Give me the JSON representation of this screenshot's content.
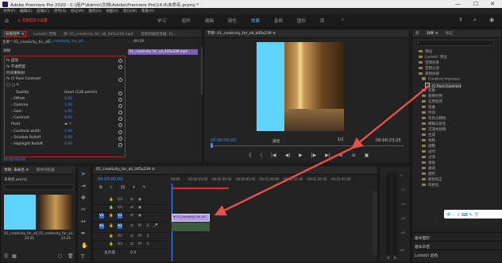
{
  "window": {
    "title": "Adobe Premiere Pro 2020 - C:\\用户\\Admin\\文档\\Adobe\\Premiere Pro\\14.0\\未命名.prproj *",
    "minimize": "—",
    "maximize": "☐",
    "close": "✕"
  },
  "menu": {
    "items": [
      "文件(F)",
      "编辑(E)",
      "剪辑(C)",
      "序列(S)",
      "标记(M)",
      "图形(G)",
      "视图(V)",
      "窗口(W)",
      "帮助(H)"
    ]
  },
  "workspaces": {
    "items": [
      "学习",
      "组件",
      "编辑",
      "颜色",
      "效果",
      "音频",
      "图形",
      "库"
    ],
    "active_index": 4,
    "more": "»"
  },
  "warning": {
    "text": "⚠ 无需自定义设置"
  },
  "effect_controls": {
    "tabs": [
      "效果控件 ≡",
      "Lumetri 范围",
      "源: 01_creativity_for_all_445x239.mp4",
      "音频剪辑混合器: 01..."
    ],
    "source": "主要 * 01_creativity_for_all...",
    "clip": "01_creativity_for_all...",
    "timecode_top": ":00:00",
    "clip_bar": "01_creativity_for_all_445x239.mp4",
    "section": "视频",
    "rows": [
      {
        "label": "fx  运动"
      },
      {
        "label": "fx  不透明度"
      },
      {
        "label": "    时间重映射"
      },
      {
        "label": "fx  CI Pure Contrast"
      },
      {
        "label": "    ◯ ▢ ✎"
      },
      {
        "label": "Quality",
        "value": "Good (128 points)"
      },
      {
        "label": "› Offset",
        "value": "0.00"
      },
      {
        "label": "› Gamma",
        "value": "1.00"
      },
      {
        "label": "› Gain",
        "value": "1.00"
      },
      {
        "label": "› Contrast",
        "value": "0.00"
      },
      {
        "label": "  Pivot",
        "value": "▬ ✎"
      },
      {
        "label": "› Contrast width",
        "value": "1.00"
      },
      {
        "label": "› Shadow Rolloff",
        "value": "0.00"
      },
      {
        "label": "› Highlight Rolloff",
        "value": "0.00"
      }
    ],
    "timecode": "00:00:00:00"
  },
  "program_monitor": {
    "tab": "节目: 01_creativity_for_all_445x239 ≡",
    "timecode_left": "00:00:00:00",
    "fit": "适合",
    "quality": "1/2",
    "timecode_right": "00:00:23:25",
    "controls": [
      "{",
      "⟨",
      "|◀",
      "◀|",
      "▶",
      "|▶",
      "▶|",
      "⊕",
      "⊖",
      "▣"
    ],
    "colors": {
      "placeholder": "#5fd4ff"
    }
  },
  "effects_panel": {
    "tabs": [
      "库",
      "效果 ≡",
      "标记"
    ],
    "items": [
      "预设",
      "Lumetri 预设",
      "音频效果",
      "音频过渡",
      "视频效果",
      "Creative Impulses",
      "Ci Pure Contrast",
      "变换",
      "图像控制",
      "实用程序",
      "扭曲",
      "时间",
      "杂色与颗粒",
      "模糊与锐化",
      "沉浸式视频",
      "生成",
      "视频",
      "调整",
      "过时",
      "过渡",
      "透视",
      "通道",
      "键控",
      "颜色校正",
      "风格化"
    ],
    "bottom_items": [
      "基本图形",
      "基本声音",
      "Lumetri 颜色"
    ]
  },
  "project_panel": {
    "tabs": [
      "项目: 未命名 ≡",
      "媒体浏览器"
    ],
    "name": "未命名.prproj",
    "clip_name": "01_creativity_for_all_44...",
    "clip_duration": "23:25",
    "sequence_name": "01_creativity_for_all...",
    "sequence_duration": "23:25"
  },
  "timeline": {
    "tab": "01_creativity_for_all_445x239 ≡",
    "timecode": "00:00:00:00",
    "ruler": [
      "00:00",
      "00:00:15:00",
      "00:00:30:00",
      "00:00:45:00",
      "00:01:00:00",
      "00:01:15:00",
      "00:01:30:00",
      "00:01:45:00"
    ],
    "tracks": [
      "V3",
      "V2",
      "V1",
      "A1",
      "A2",
      "A3"
    ],
    "master": "主声道",
    "master_value": "0.0",
    "clip_label": "fx 01_creativity_for_all"
  },
  "taskbar_ime": {
    "label": "中 ⁘ ♪ ⌨ ✎ 👕"
  },
  "audio_meter": {
    "scale": [
      "0",
      "-12",
      "-24",
      "-36",
      "-48",
      "dB"
    ],
    "solo": "S"
  }
}
